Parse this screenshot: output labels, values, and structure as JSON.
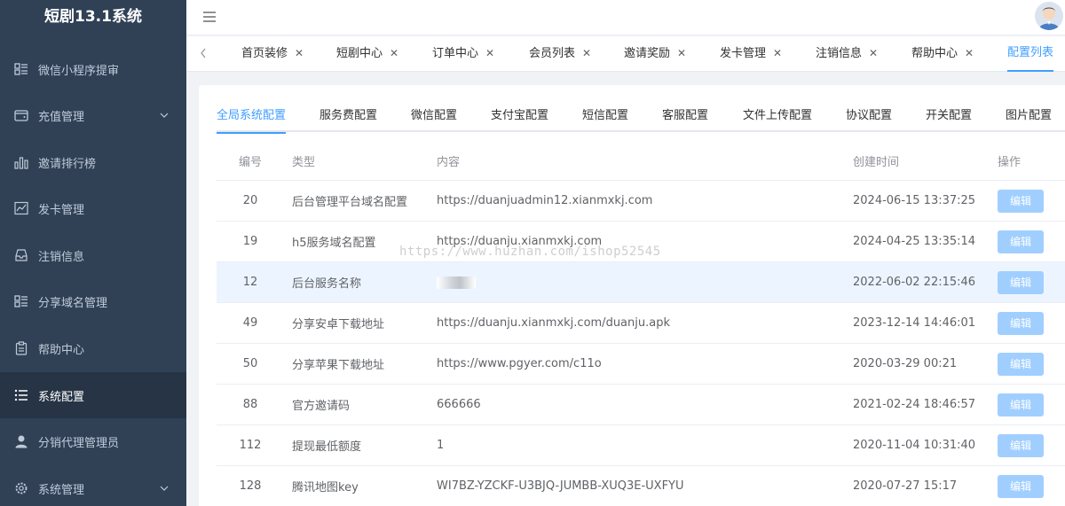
{
  "app": {
    "title": "短剧13.1系统"
  },
  "sidebar": {
    "items": [
      {
        "label": "微信小程序提审",
        "icon": "list-icon"
      },
      {
        "label": "充值管理",
        "icon": "wallet-icon",
        "has_arrow": true
      },
      {
        "label": "邀请排行榜",
        "icon": "bar-chart-icon"
      },
      {
        "label": "发卡管理",
        "icon": "line-chart-icon"
      },
      {
        "label": "注销信息",
        "icon": "inbox-icon"
      },
      {
        "label": "分享域名管理",
        "icon": "list-icon"
      },
      {
        "label": "帮助中心",
        "icon": "clipboard-icon"
      },
      {
        "label": "系统配置",
        "icon": "menu-lines-icon",
        "active": true
      },
      {
        "label": "分销代理管理员",
        "icon": "user-icon"
      },
      {
        "label": "系统管理",
        "icon": "gear-icon",
        "has_arrow": true
      }
    ]
  },
  "tags": {
    "items": [
      {
        "label": "首页装修"
      },
      {
        "label": "短剧中心"
      },
      {
        "label": "订单中心"
      },
      {
        "label": "会员列表"
      },
      {
        "label": "邀请奖励"
      },
      {
        "label": "发卡管理"
      },
      {
        "label": "注销信息"
      },
      {
        "label": "帮助中心"
      },
      {
        "label": "配置列表",
        "active": true
      }
    ],
    "close_glyph": "✕"
  },
  "config_tabs": {
    "items": [
      {
        "label": "全局系统配置",
        "active": true
      },
      {
        "label": "服务费配置"
      },
      {
        "label": "微信配置"
      },
      {
        "label": "支付宝配置"
      },
      {
        "label": "短信配置"
      },
      {
        "label": "客服配置"
      },
      {
        "label": "文件上传配置"
      },
      {
        "label": "协议配置"
      },
      {
        "label": "开关配置"
      },
      {
        "label": "图片配置"
      }
    ]
  },
  "table": {
    "headers": {
      "id": "编号",
      "type": "类型",
      "content": "内容",
      "time": "创建时间",
      "op": "操作"
    },
    "edit_label": "编辑",
    "rows": [
      {
        "id": "20",
        "type": "后台管理平台域名配置",
        "content": "https://duanjuadmin12.xianmxkj.com",
        "time": "2024-06-15 13:37:25"
      },
      {
        "id": "19",
        "type": "h5服务域名配置",
        "content": "https://duanju.xianmxkj.com",
        "time": "2024-04-25 13:35:14"
      },
      {
        "id": "12",
        "type": "后台服务名称",
        "content": "",
        "time": "2022-06-02 22:15:46",
        "highlight": true,
        "blurred": true
      },
      {
        "id": "49",
        "type": "分享安卓下载地址",
        "content": "https://duanju.xianmxkj.com/duanju.apk",
        "time": "2023-12-14 14:46:01"
      },
      {
        "id": "50",
        "type": "分享苹果下载地址",
        "content": "https://www.pgyer.com/c11o",
        "time": "2020-03-29 00:21"
      },
      {
        "id": "88",
        "type": "官方邀请码",
        "content": "666666",
        "time": "2021-02-24 18:46:57"
      },
      {
        "id": "112",
        "type": "提现最低额度",
        "content": "1",
        "time": "2020-11-04 10:31:40"
      },
      {
        "id": "128",
        "type": "腾讯地图key",
        "content": "WI7BZ-YZCKF-U3BJQ-JUMBB-XUQ3E-UXFYU",
        "time": "2020-07-27 15:17"
      }
    ]
  },
  "watermark": {
    "text": "https://www.huzhan.com/ishop52545"
  },
  "colors": {
    "sidebar_bg": "#304156",
    "sidebar_active": "#263445",
    "accent": "#409eff",
    "edit_button": "#a0cfff",
    "row_highlight": "#ecf5ff"
  }
}
